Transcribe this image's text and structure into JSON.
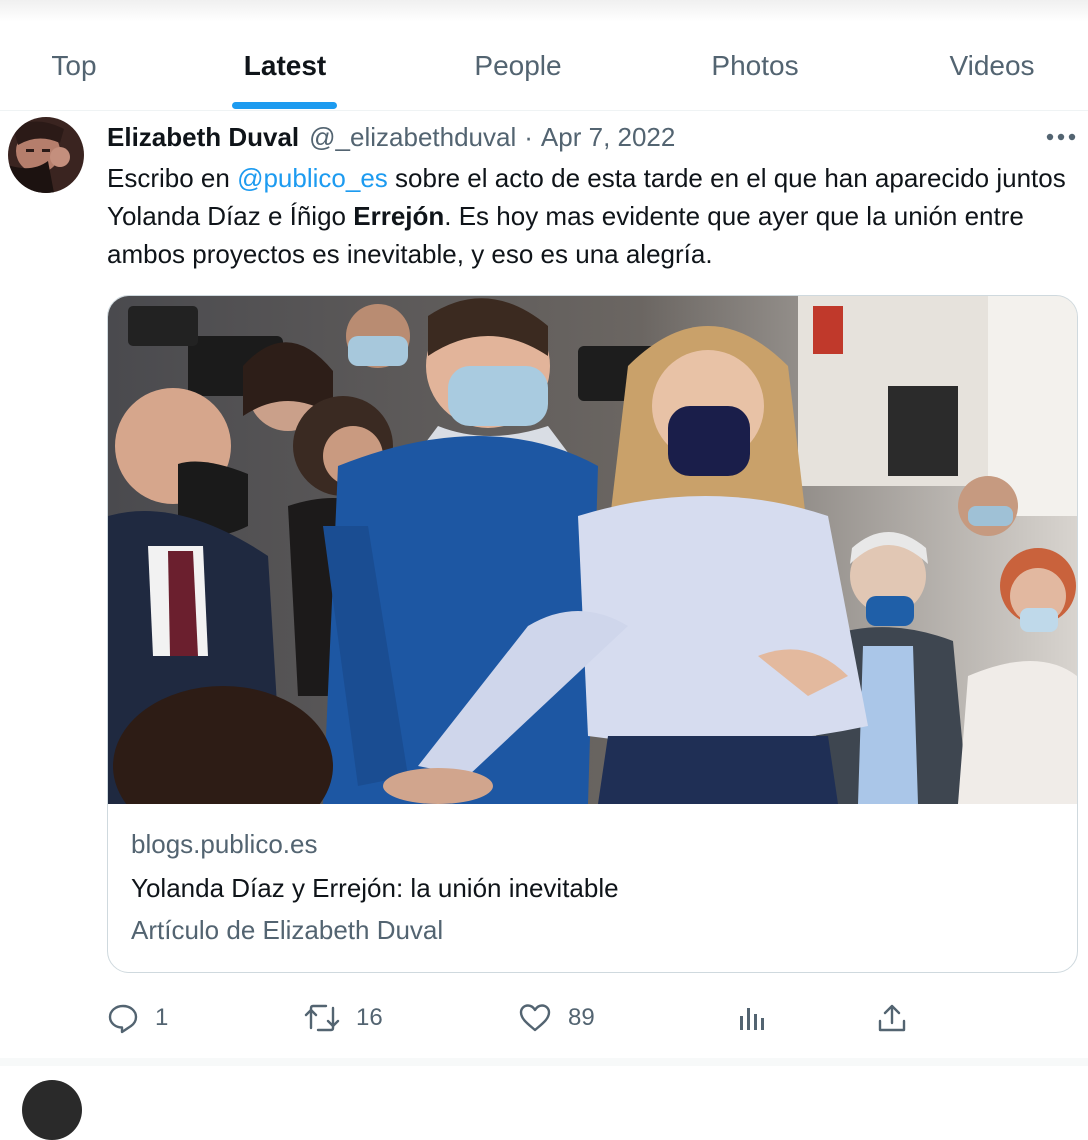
{
  "tabs": [
    {
      "label": "Top",
      "active": false
    },
    {
      "label": "Latest",
      "active": true
    },
    {
      "label": "People",
      "active": false
    },
    {
      "label": "Photos",
      "active": false
    },
    {
      "label": "Videos",
      "active": false
    }
  ],
  "tweet": {
    "author_name": "Elizabeth Duval",
    "handle": "@_elizabethduval",
    "separator": "·",
    "date": "Apr 7, 2022",
    "text": {
      "part1": "Escribo en ",
      "mention": "@publico_es",
      "part2": " sobre el acto de esta tarde en el que han aparecido juntos Yolanda Díaz e Íñigo ",
      "bold": "Errejón",
      "part3": ". Es hoy mas evidente que ayer que la unión entre ambos proyectos es inevitable, y eso es una alegría."
    },
    "card": {
      "domain": "blogs.publico.es",
      "title": "Yolanda Díaz y Errejón: la unión inevitable",
      "description": "Artículo de Elizabeth Duval"
    },
    "actions": {
      "reply_count": "1",
      "retweet_count": "16",
      "like_count": "89"
    }
  },
  "colors": {
    "accent": "#1d9bf0",
    "text_primary": "#0f1419",
    "text_secondary": "#536471",
    "border": "#cfd9de"
  },
  "icons": {
    "more": "more-icon",
    "reply": "reply-icon",
    "retweet": "retweet-icon",
    "like": "heart-icon",
    "views": "views-icon",
    "share": "share-icon"
  }
}
